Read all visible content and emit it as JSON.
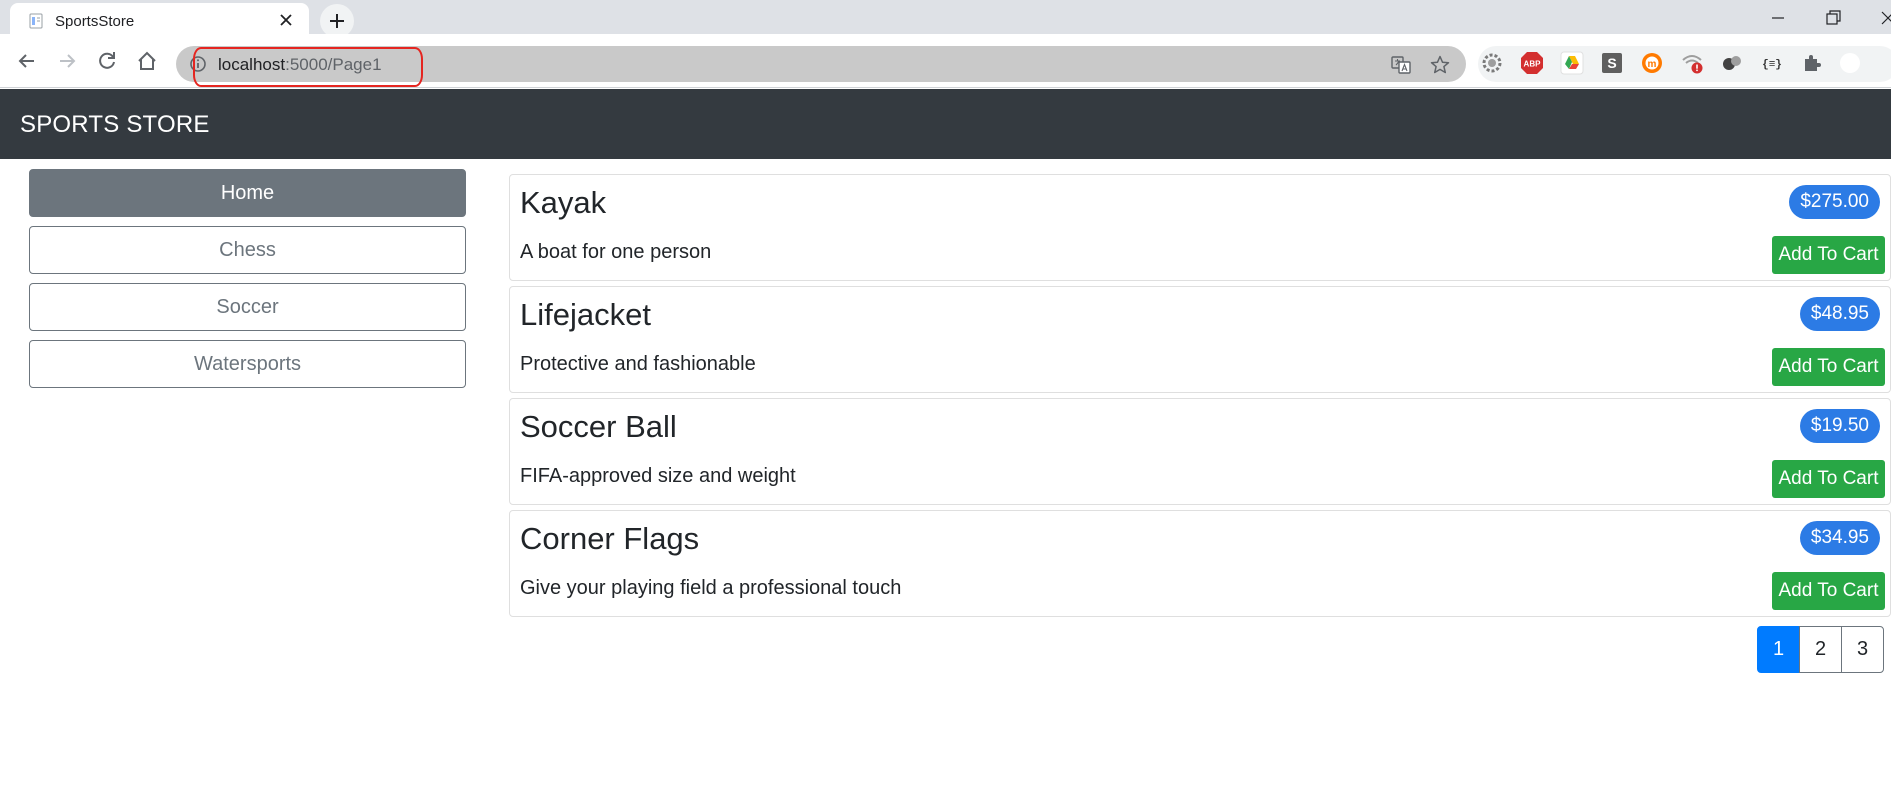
{
  "browser": {
    "tab_title": "SportsStore",
    "url_host": "localhost",
    "url_path": ":5000/Page1",
    "extensions": [
      "settings-gear-icon",
      "adblock-icon",
      "drive-icon",
      "s-icon",
      "m-icon",
      "wifi-alert-icon",
      "extension-balls-icon",
      "json-icon",
      "puzzle-icon"
    ]
  },
  "site": {
    "brand": "SPORTS STORE"
  },
  "categories": [
    {
      "label": "Home",
      "active": true
    },
    {
      "label": "Chess",
      "active": false
    },
    {
      "label": "Soccer",
      "active": false
    },
    {
      "label": "Watersports",
      "active": false
    }
  ],
  "products": [
    {
      "name": "Kayak",
      "description": "A boat for one person",
      "price": "$275.00",
      "button": "Add To Cart"
    },
    {
      "name": "Lifejacket",
      "description": "Protective and fashionable",
      "price": "$48.95",
      "button": "Add To Cart"
    },
    {
      "name": "Soccer Ball",
      "description": "FIFA-approved size and weight",
      "price": "$19.50",
      "button": "Add To Cart"
    },
    {
      "name": "Corner Flags",
      "description": "Give your playing field a professional touch",
      "price": "$34.95",
      "button": "Add To Cart"
    }
  ],
  "pagination": {
    "pages": [
      "1",
      "2",
      "3"
    ],
    "current": "1"
  },
  "colors": {
    "header_bg": "#343a40",
    "primary": "#007bff",
    "badge": "#2c7be5",
    "success": "#28a745",
    "secondary": "#6c757d",
    "annotation": "#e52520"
  }
}
